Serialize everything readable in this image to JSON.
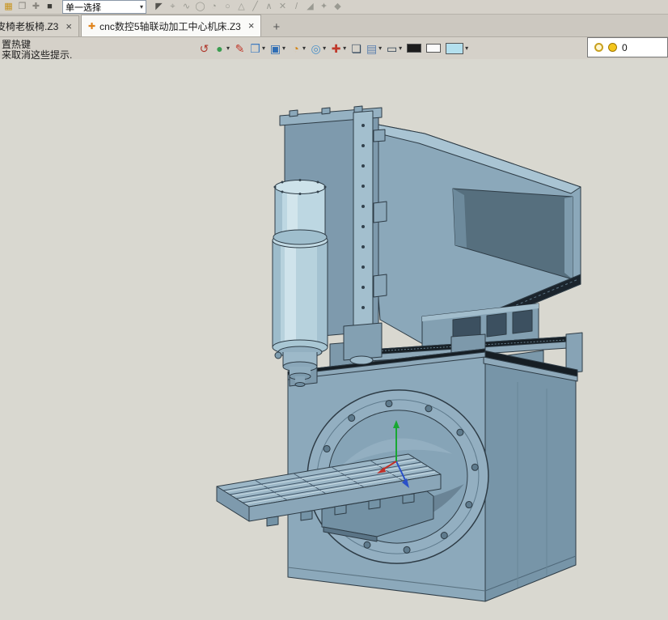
{
  "top_toolbar": {
    "selection_combo": {
      "value": "单一选择"
    },
    "left_icons": [
      {
        "name": "app-logo-icon",
        "glyph": "▦",
        "color": "#c8941c"
      },
      {
        "name": "clipboard-icon",
        "glyph": "❐",
        "color": "#88857e"
      },
      {
        "name": "pin-icon",
        "glyph": "✚",
        "color": "#88857e"
      },
      {
        "name": "fill-swatch-icon",
        "glyph": "■",
        "color": "#3c3c38"
      }
    ],
    "filter_icons": [
      {
        "name": "select-arrow-icon",
        "glyph": "◤",
        "color": "#55544f"
      },
      {
        "name": "snap-point-icon",
        "glyph": "⌖",
        "color": "#9a9a92"
      },
      {
        "name": "snap-curve-icon",
        "glyph": "∿",
        "color": "#9a9a92"
      },
      {
        "name": "snap-circle-icon",
        "glyph": "◯",
        "color": "#9a9a92"
      },
      {
        "name": "snap-arc-icon",
        "glyph": "◔",
        "color": "#9a9a92"
      },
      {
        "name": "snap-ellipse-icon",
        "glyph": "○",
        "color": "#9a9a92"
      },
      {
        "name": "snap-triangle-icon",
        "glyph": "△",
        "color": "#9a9a92"
      },
      {
        "name": "snap-line-icon",
        "glyph": "╱",
        "color": "#9a9a92"
      },
      {
        "name": "snap-polyline-icon",
        "glyph": "∧",
        "color": "#9a9a92"
      },
      {
        "name": "snap-cross-icon",
        "glyph": "✕",
        "color": "#9a9a92"
      },
      {
        "name": "snap-slash-icon",
        "glyph": "/",
        "color": "#9a9a92"
      },
      {
        "name": "snap-corner-icon",
        "glyph": "◢",
        "color": "#9a9a92"
      },
      {
        "name": "snap-star-icon",
        "glyph": "✦",
        "color": "#9a9a92"
      },
      {
        "name": "snap-diamond-icon",
        "glyph": "◆",
        "color": "#9a9a92"
      }
    ]
  },
  "tab_bar": {
    "tabs": [
      {
        "label": "皮椅老板椅.Z3",
        "active": false
      },
      {
        "label": "cnc数控5轴联动加工中心机床.Z3",
        "active": true
      }
    ],
    "close_glyph": "×",
    "doc_icon_glyph": "✚",
    "new_tab_glyph": "+"
  },
  "view_toolbar": {
    "icons": [
      {
        "name": "regen-refresh-icon",
        "glyph": "↺",
        "color": "#b03a2e"
      },
      {
        "name": "material-render-icon",
        "glyph": "●",
        "color": "#3a9d4f",
        "dropdown": true
      },
      {
        "name": "measure-pencil-icon",
        "glyph": "✎",
        "color": "#c0392b"
      },
      {
        "name": "isometric-view-cube-icon",
        "glyph": "❒",
        "color": "#3f7cc0",
        "dropdown": true
      },
      {
        "name": "view-orientation-cube-icon",
        "glyph": "▣",
        "color": "#2f6db4",
        "dropdown": true
      },
      {
        "name": "color-wheel-icon",
        "glyph": "◔",
        "color": "#d4881c",
        "dropdown": true
      },
      {
        "name": "shade-mode-icon",
        "glyph": "◎",
        "color": "#4a90c8",
        "dropdown": true
      },
      {
        "name": "axis-target-icon",
        "glyph": "✚",
        "color": "#c0392b",
        "dropdown": true
      },
      {
        "name": "window-zoom-icon",
        "glyph": "❏",
        "color": "#34495e"
      },
      {
        "name": "grid-ruler-icon",
        "glyph": "▤",
        "color": "#5a7fae",
        "dropdown": true
      },
      {
        "name": "display-monitor-icon",
        "glyph": "▭",
        "color": "#2c3e50",
        "dropdown": true
      },
      {
        "name": "black-color-swatch",
        "bg": "#1c1c1c",
        "cls": "swatch"
      },
      {
        "name": "white-color-swatch",
        "bg": "#fbfbfb",
        "cls": "swatch"
      },
      {
        "name": "background-color-swatch",
        "bg": "#b4e0ee",
        "cls": "swatch swatch-lg",
        "dropdown": true
      }
    ],
    "light_count": "0"
  },
  "hints": {
    "line1": "置热键",
    "line2": "来取消这些提示."
  },
  "canvas": {
    "model_name": "cnc数控5轴联动加工中心机床",
    "model_color": "#8ca9bb",
    "background": "#d9d8d0"
  }
}
